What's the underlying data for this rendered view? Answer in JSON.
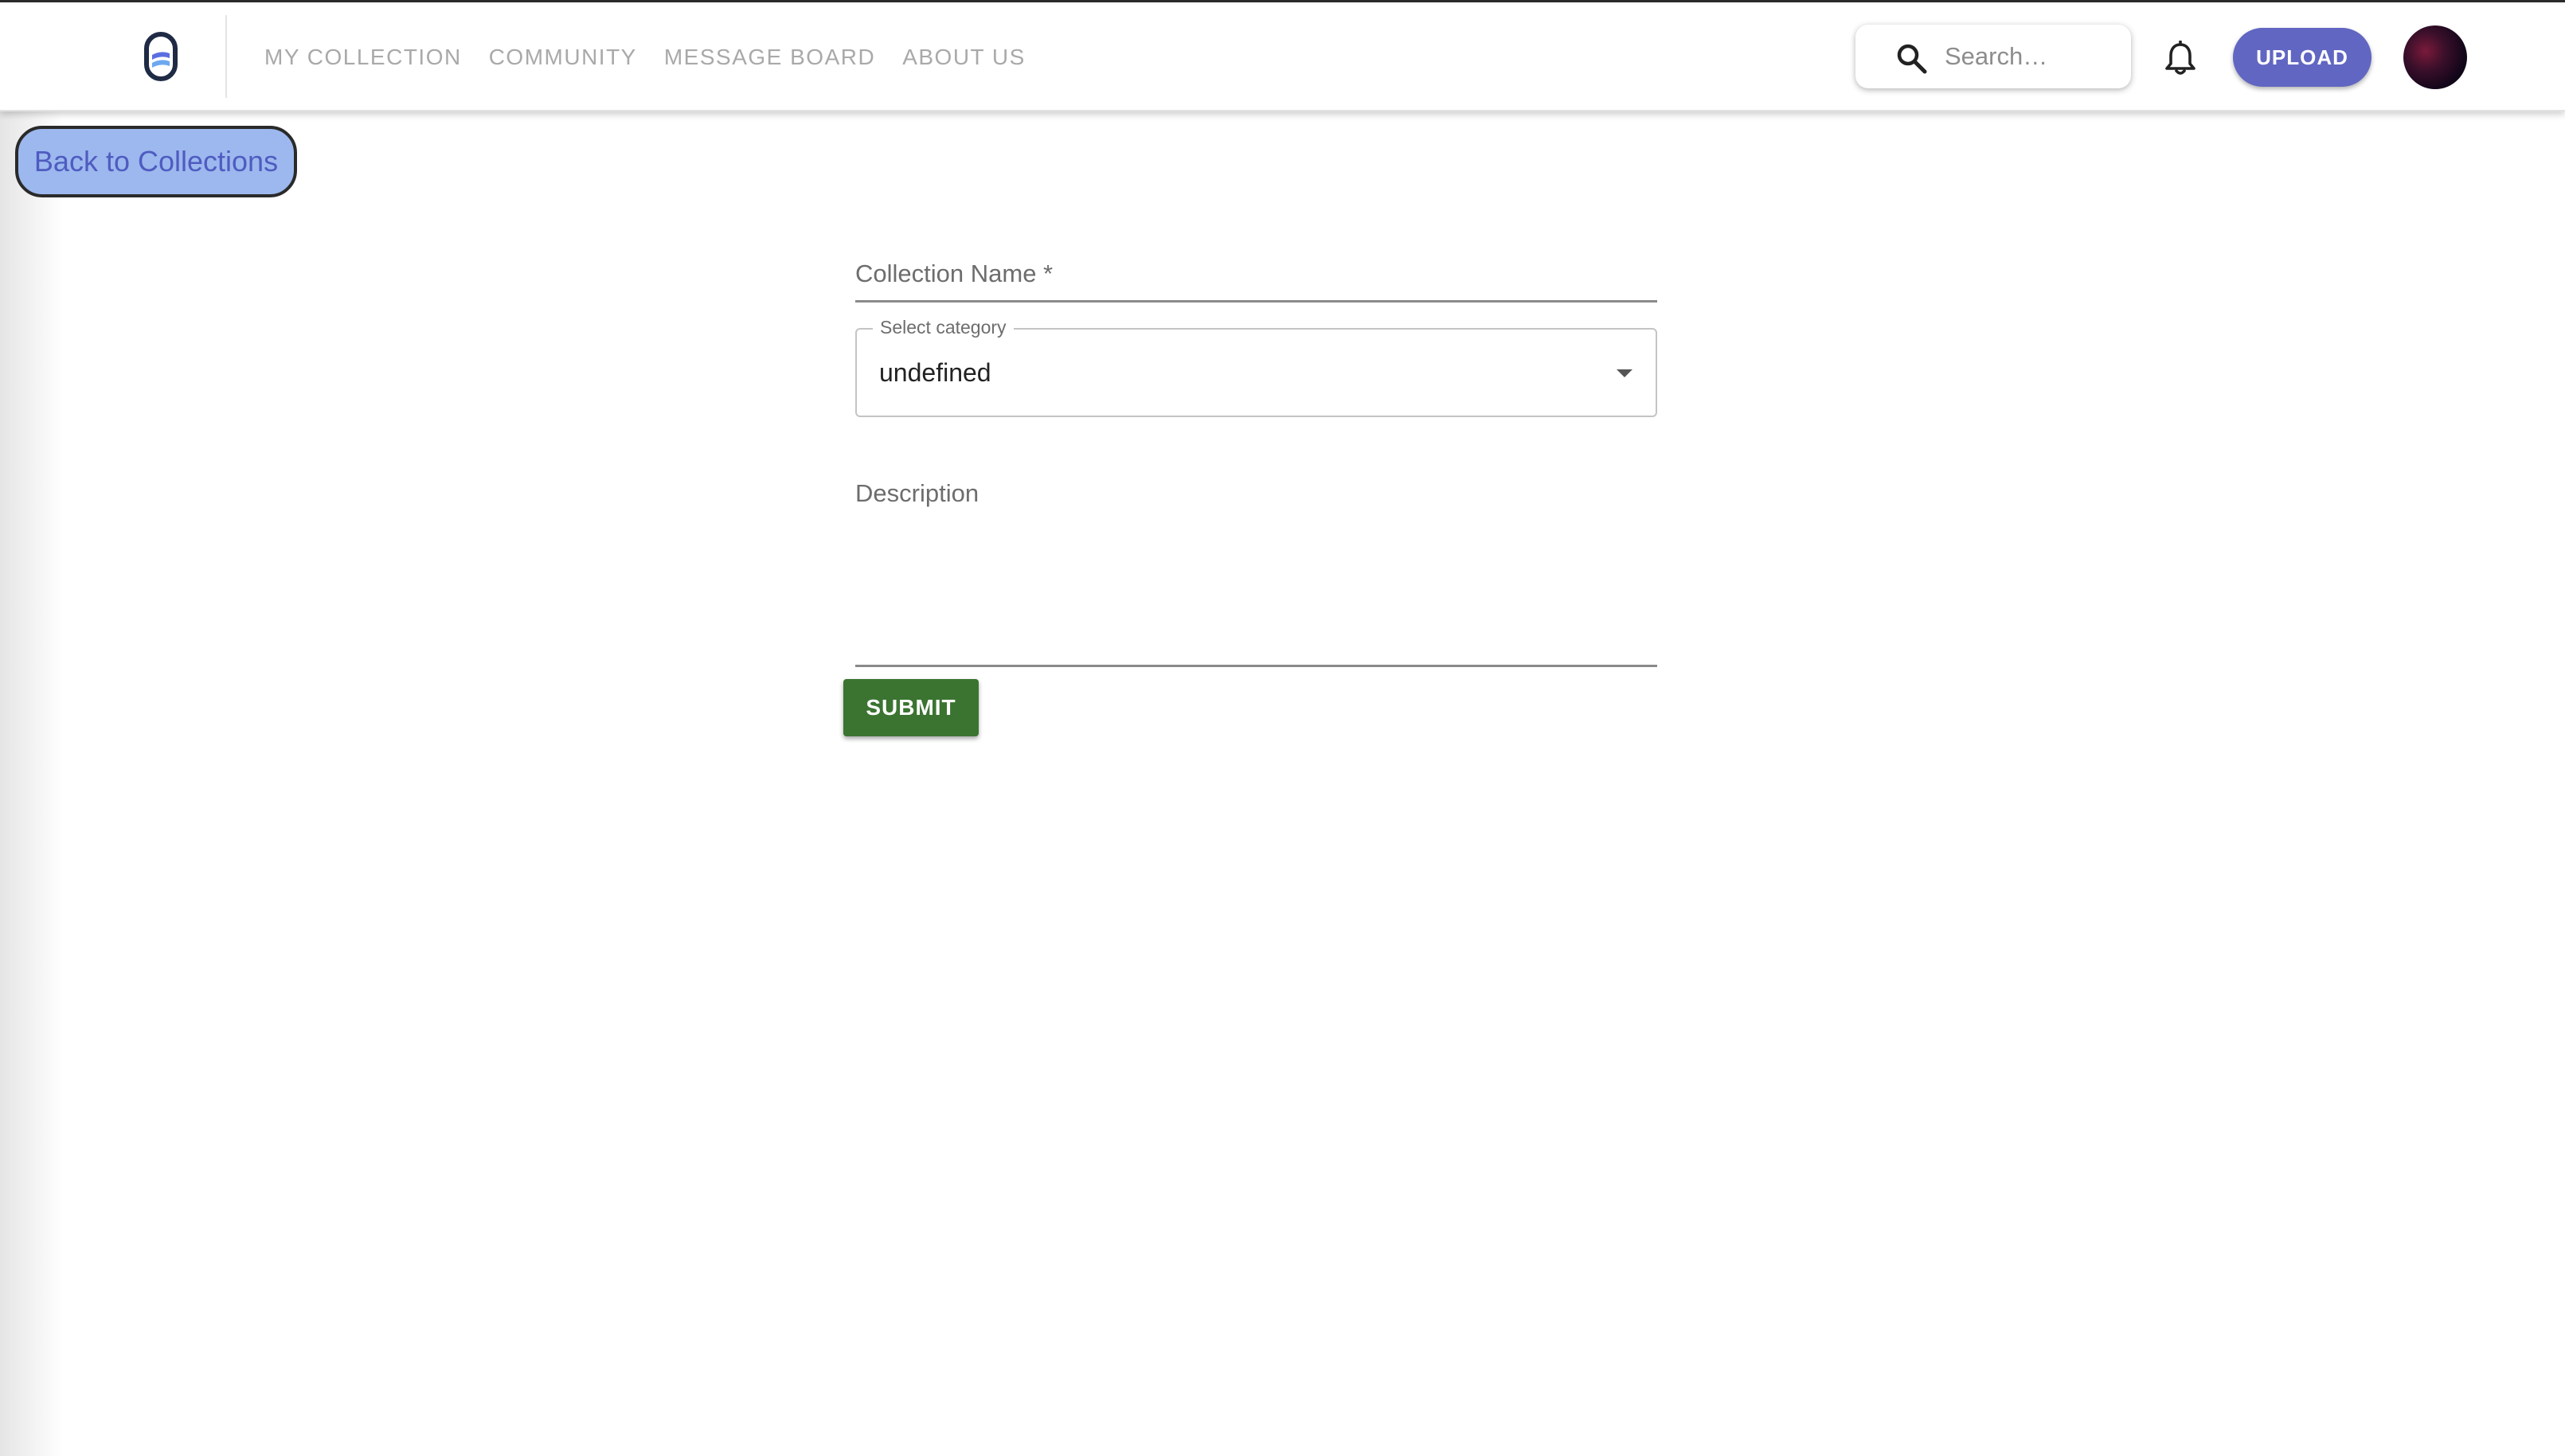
{
  "nav": {
    "items": [
      "MY COLLECTION",
      "COMMUNITY",
      "MESSAGE BOARD",
      "ABOUT US"
    ]
  },
  "search": {
    "placeholder": "Search…",
    "value": ""
  },
  "header": {
    "upload_label": "UPLOAD"
  },
  "page": {
    "back_label": "Back to Collections"
  },
  "form": {
    "name_label": "Collection Name *",
    "name_value": "",
    "category_legend": "Select category",
    "category_value": "undefined",
    "description_label": "Description",
    "description_value": "",
    "submit_label": "SUBMIT"
  },
  "colors": {
    "accent": "#6166c2",
    "submit": "#3b7431",
    "back_button_bg": "#9cb8ee",
    "back_button_text": "#4f5bc0",
    "nav_text": "#a9a9a9"
  },
  "icons": [
    "logo-icon",
    "search-icon",
    "bell-icon",
    "dropdown-arrow-icon"
  ]
}
